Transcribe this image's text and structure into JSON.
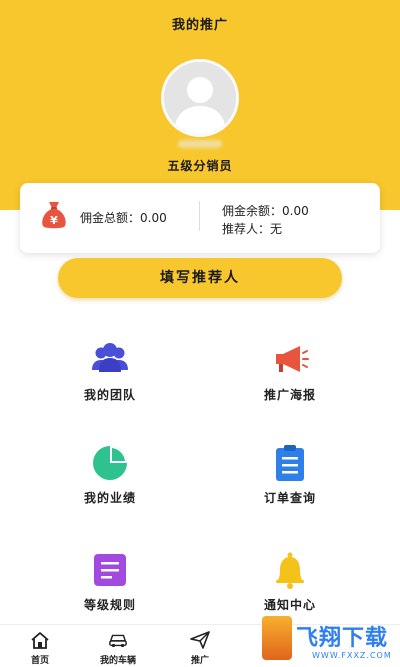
{
  "header": {
    "title": "我的推广",
    "level": "五级分销员"
  },
  "card": {
    "total_commission": "佣金总额：0.00",
    "balance_commission": "佣金余额：0.00",
    "referrer": "推荐人：无"
  },
  "fill_button": "填写推荐人",
  "grid": [
    {
      "label": "我的团队",
      "icon": "team-icon",
      "color": "#4A4FD8"
    },
    {
      "label": "推广海报",
      "icon": "megaphone-icon",
      "color": "#E8553F"
    },
    {
      "label": "我的业绩",
      "icon": "pie-chart-icon",
      "color": "#2EC28E"
    },
    {
      "label": "订单查询",
      "icon": "clipboard-icon",
      "color": "#2E7FE8"
    },
    {
      "label": "等级规则",
      "icon": "document-icon",
      "color": "#A24ADF"
    },
    {
      "label": "通知中心",
      "icon": "bell-icon",
      "color": "#F5C21A"
    }
  ],
  "bottom_nav": [
    {
      "label": "首页",
      "icon": "home-icon"
    },
    {
      "label": "我的车辆",
      "icon": "car-icon"
    },
    {
      "label": "推广",
      "icon": "send-icon"
    }
  ],
  "watermark": {
    "text": "飞翔下载",
    "sub": "WWW.FXXZ.COM"
  },
  "colors": {
    "primary_yellow": "#F8C72E"
  }
}
